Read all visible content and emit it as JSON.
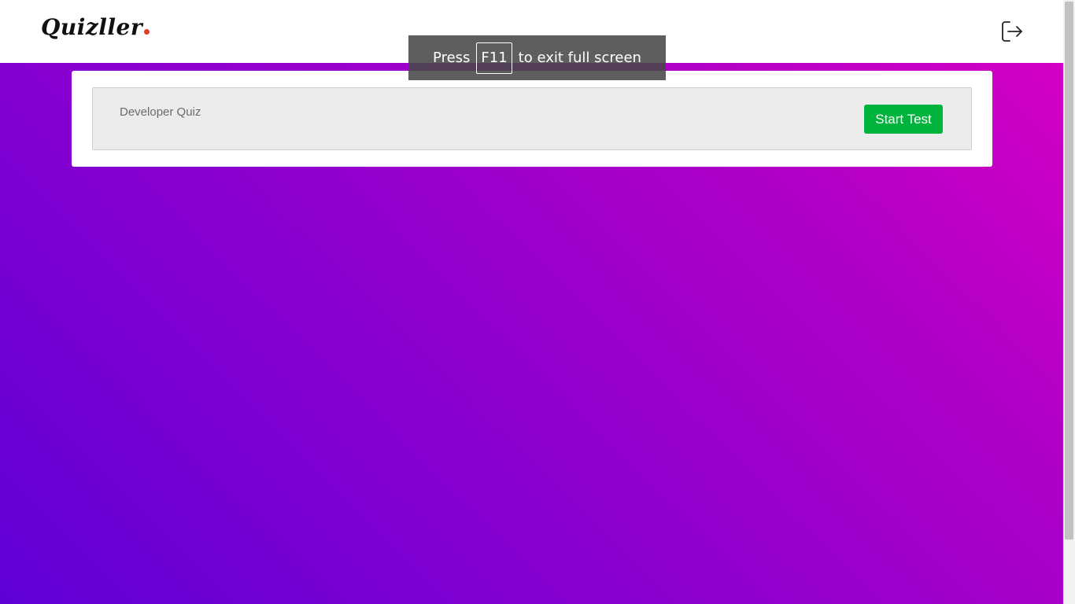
{
  "navbar": {
    "brand": "Quizller",
    "logout_icon": "logout-icon"
  },
  "quizzes": [
    {
      "title": "Developer Quiz",
      "action_label": "Start Test"
    }
  ],
  "fullscreen_toast": {
    "prefix": "Press",
    "key": "F11",
    "suffix": "to exit full screen"
  },
  "colors": {
    "gradient_start": "#5f00d8",
    "gradient_end": "#d400c4",
    "start_button": "#00b33c",
    "brand_dot": "#e63a2e"
  }
}
